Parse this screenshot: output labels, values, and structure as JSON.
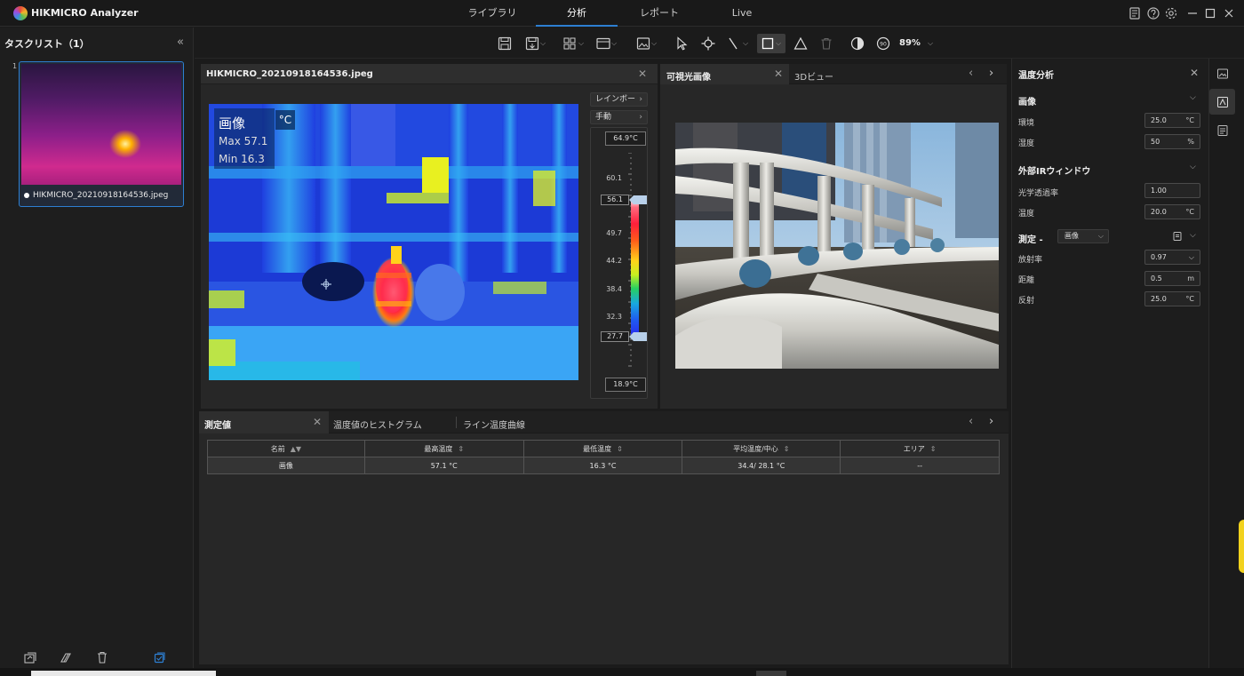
{
  "app": {
    "title": "HIKMICRO Analyzer"
  },
  "main_tabs": [
    {
      "label": "ライブラリ",
      "active": false
    },
    {
      "label": "分析",
      "active": true
    },
    {
      "label": "レポート",
      "active": false
    },
    {
      "label": "Live",
      "active": false
    }
  ],
  "title_icons": [
    "notes-icon",
    "help-icon",
    "settings-icon",
    "minimize-icon",
    "maximize-icon",
    "close-icon"
  ],
  "task_list": {
    "title": "タスクリスト（1）",
    "items": [
      {
        "index": "1",
        "filename": "HIKMICRO_20210918164536.jpeg",
        "selected": true
      }
    ]
  },
  "toolbar": {
    "icons": [
      "save-icon",
      "save-as-icon",
      "layout-grid-icon",
      "display-mode-icon",
      "image-edit-icon",
      "pointer-icon",
      "point-tool-icon",
      "line-tool-icon",
      "rectangle-tool-icon",
      "polygon-tool-icon",
      "delete-icon",
      "contrast-icon",
      "rotate-90-icon"
    ],
    "zoom": "89%"
  },
  "image_panel": {
    "title": "HIKMICRO_20210918164536.jpeg",
    "overlay": {
      "title": "画像",
      "unit": "°C",
      "max": "Max 57.1",
      "min": "Min 16.3"
    },
    "palette": "レインボー",
    "range_mode": "手動",
    "scale_max": "64.9°C",
    "scale_min": "18.9°C",
    "ticks": [
      "60.1",
      "49.7",
      "44.2",
      "38.4",
      "32.3"
    ],
    "marker_high": "56.1",
    "marker_low": "27.7"
  },
  "visible_panel": {
    "tab_active": "可視光画像",
    "tab_other": "3Dビュー"
  },
  "right_panel": {
    "title": "温度分析",
    "section_image": "画像",
    "ambient_label": "環境",
    "ambient_value": "25.0",
    "ambient_unit": "°C",
    "humidity_label": "湿度",
    "humidity_value": "50",
    "humidity_unit": "%",
    "section_ir": "外部IRウィンドウ",
    "transmittance_label": "光学透過率",
    "transmittance_value": "1.00",
    "ir_temp_label": "温度",
    "ir_temp_value": "20.0",
    "ir_temp_unit": "°C",
    "section_measure": "測定 -",
    "measure_target": "画像",
    "emissivity_label": "放射率",
    "emissivity_value": "0.97",
    "distance_label": "距離",
    "distance_value": "0.5",
    "distance_unit": "m",
    "reflected_label": "反射",
    "reflected_value": "25.0",
    "reflected_unit": "°C"
  },
  "measurements": {
    "tabs": [
      "測定値",
      "温度値のヒストグラム",
      "ライン温度曲線"
    ],
    "columns": [
      "名前",
      "最高温度",
      "最低温度",
      "平均温度/中心",
      "エリア"
    ],
    "rows": [
      [
        "画像",
        "57.1 °C",
        "16.3 °C",
        "34.4/ 28.1 °C",
        "--"
      ]
    ]
  },
  "colors": {
    "accent": "#2d7fd2",
    "background": "#1b1b1b",
    "panel": "#272727"
  }
}
